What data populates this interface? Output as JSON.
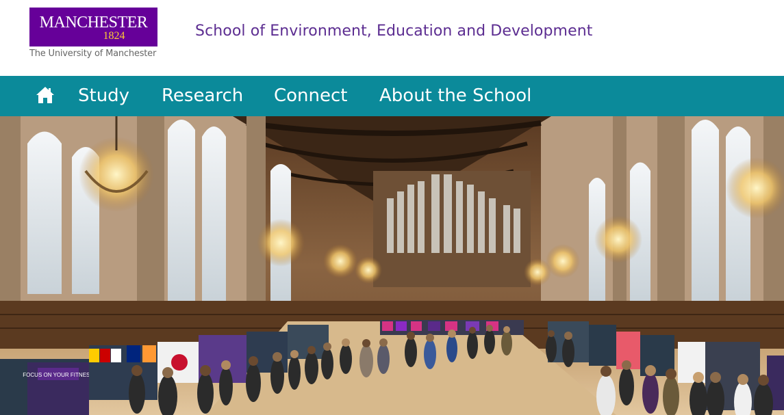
{
  "header": {
    "logo_word": "MANCHESTER",
    "logo_year": "1824",
    "logo_subtitle": "The University of Manchester",
    "school_title": "School of Environment, Education and Development"
  },
  "nav": {
    "home_icon": "home-icon",
    "items": [
      {
        "label": "Study"
      },
      {
        "label": "Research"
      },
      {
        "label": "Connect"
      },
      {
        "label": "About the School"
      }
    ]
  },
  "hero": {
    "image_semantic": "great-hall-event-photo",
    "signs": {
      "fitness": "FOCUS ON YOUR FITNESS"
    }
  },
  "colors": {
    "brand_purple": "#660099",
    "title_purple": "#5c2d91",
    "nav_teal": "#0b8a9a",
    "logo_gold": "#ffcc33"
  }
}
